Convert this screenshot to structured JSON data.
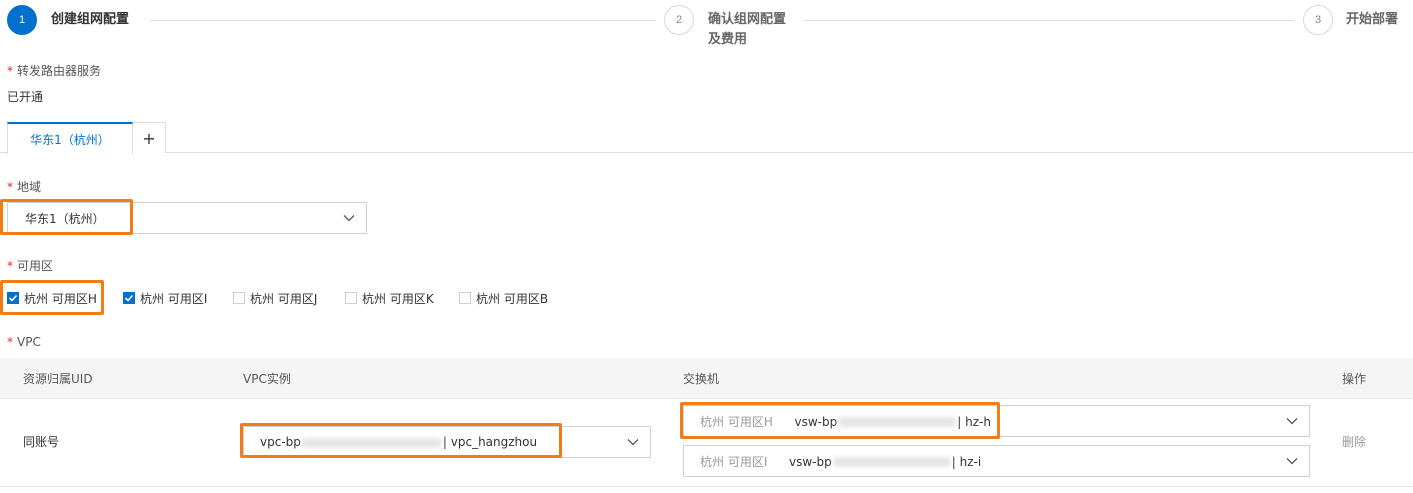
{
  "steps": [
    {
      "number": "1",
      "title": "创建组网配置"
    },
    {
      "number": "2",
      "title_line1": "确认组网配置",
      "title_line2": "及费用"
    },
    {
      "number": "3",
      "title": "开始部署"
    }
  ],
  "required_mark": "*",
  "router_service": {
    "label": "转发路由器服务",
    "value": "已开通"
  },
  "tabs": {
    "active_label": "华东1（杭州）",
    "add_label": "+"
  },
  "region": {
    "label": "地域",
    "value": "华东1（杭州）"
  },
  "zones": {
    "label": "可用区",
    "options": [
      {
        "label": "杭州 可用区H",
        "checked": true
      },
      {
        "label": "杭州 可用区I",
        "checked": true
      },
      {
        "label": "杭州 可用区J",
        "checked": false
      },
      {
        "label": "杭州 可用区K",
        "checked": false
      },
      {
        "label": "杭州 可用区B",
        "checked": false
      }
    ]
  },
  "vpc": {
    "label": "VPC",
    "columns": [
      "资源归属UID",
      "VPC实例",
      "交换机",
      "操作"
    ],
    "row": {
      "uid": "同账号",
      "vpc_prefix": "vpc-bp",
      "vpc_suffix": "| vpc_hangzhou",
      "vswitches": [
        {
          "zone": "杭州 可用区H",
          "prefix": "vsw-bp",
          "suffix": "| hz-h"
        },
        {
          "zone": "杭州 可用区I",
          "prefix": "vsw-bp",
          "suffix": "| hz-i"
        }
      ],
      "action": "删除"
    }
  },
  "colors": {
    "accent": "#0070cc",
    "highlight": "#f07d1a",
    "required": "#d93026"
  },
  "icons": [
    "check-icon",
    "chevron-down-icon",
    "plus-icon"
  ]
}
